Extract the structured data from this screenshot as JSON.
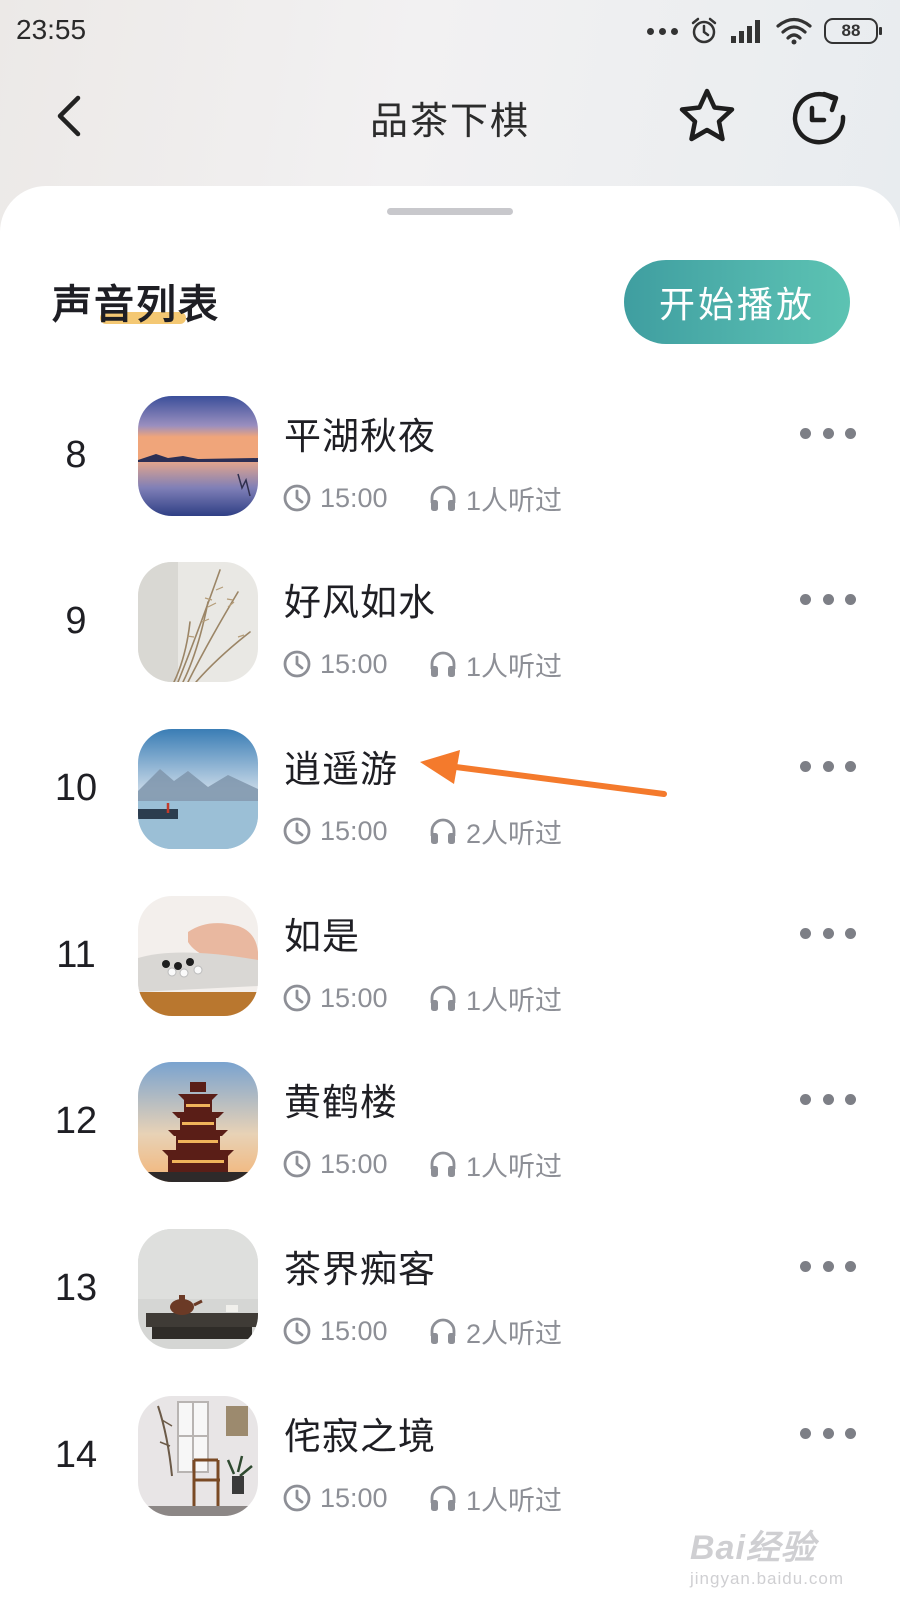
{
  "status_bar": {
    "time": "23:55",
    "battery": "88",
    "icons": [
      "more-dots-icon",
      "alarm-icon",
      "signal-icon",
      "wifi-icon",
      "battery-icon"
    ]
  },
  "header": {
    "title": "品茶下棋",
    "back_icon": "chevron-left-icon",
    "favorite_icon": "star-icon",
    "refresh_icon": "refresh-icon"
  },
  "section": {
    "title": "声音列表",
    "play_all_label": "开始播放",
    "accent_color": "#4fb1ab",
    "underline_color": "#f4c873"
  },
  "tracks": [
    {
      "number": "8",
      "title": "平湖秋夜",
      "duration": "15:00",
      "listeners": "1人听过",
      "thumbnail": "lake-sunset"
    },
    {
      "number": "9",
      "title": "好风如水",
      "duration": "15:00",
      "listeners": "1人听过",
      "thumbnail": "dried-grass"
    },
    {
      "number": "10",
      "title": "逍遥游",
      "duration": "15:00",
      "listeners": "2人听过",
      "thumbnail": "misty-mountains"
    },
    {
      "number": "11",
      "title": "如是",
      "duration": "15:00",
      "listeners": "1人听过",
      "thumbnail": "go-board-hand"
    },
    {
      "number": "12",
      "title": "黄鹤楼",
      "duration": "15:00",
      "listeners": "1人听过",
      "thumbnail": "yellow-crane-tower"
    },
    {
      "number": "13",
      "title": "茶界痴客",
      "duration": "15:00",
      "listeners": "2人听过",
      "thumbnail": "teapot-table"
    },
    {
      "number": "14",
      "title": "侘寂之境",
      "duration": "15:00",
      "listeners": "1人听过",
      "thumbnail": "chair-room"
    }
  ],
  "annotation": {
    "color": "#f47a2c"
  },
  "watermark": {
    "main": "Bai经验",
    "sub": "jingyan.baidu.com"
  }
}
